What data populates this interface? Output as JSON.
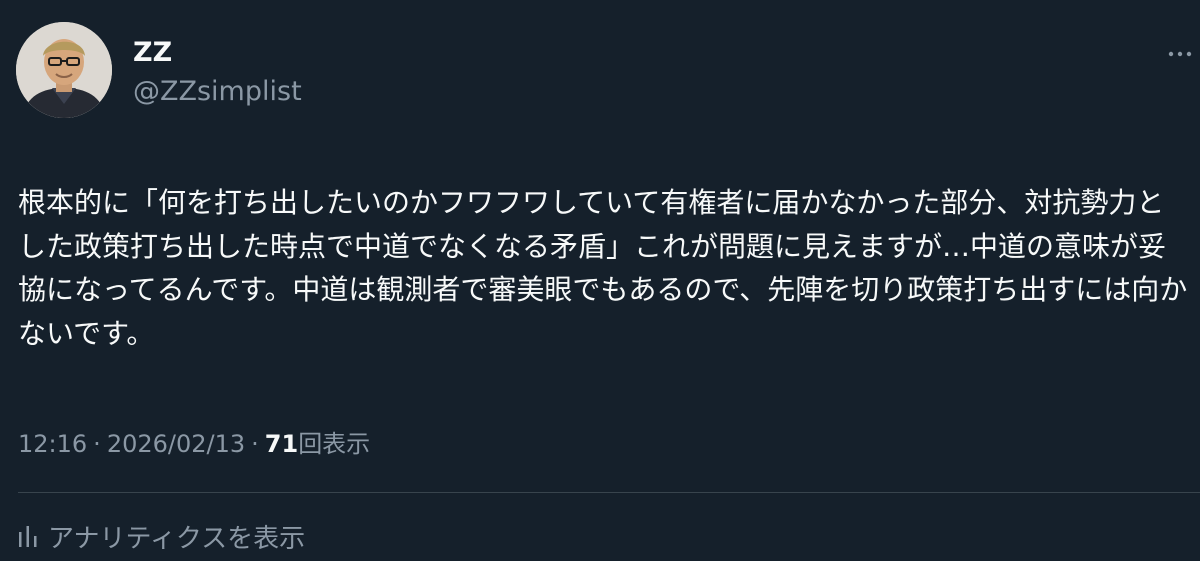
{
  "user": {
    "display_name": "ZZ",
    "handle": "@ZZsimplist"
  },
  "tweet": {
    "text": "根本的に「何を打ち出したいのかフワフワしていて有権者に届かなかった部分、対抗勢力とした政策打ち出した時点で中道でなくなる矛盾」これが問題に見えますが…中道の意味が妥協になってるんです。中道は観測者で審美眼でもあるので、先陣を切り政策打ち出すには向かないです。",
    "time": "12:16",
    "separator": "·",
    "date": "2026/02/13",
    "views_count": "71",
    "views_label": "回表示"
  },
  "actions": {
    "analytics_label": "アナリティクスを表示"
  },
  "icons": {
    "more": "more-horizontal-icon",
    "analytics": "bar-chart-icon"
  },
  "colors": {
    "background": "#15202b",
    "primary_text": "#f7f9f9",
    "secondary_text": "#8b98a5",
    "divider": "#38444d"
  }
}
